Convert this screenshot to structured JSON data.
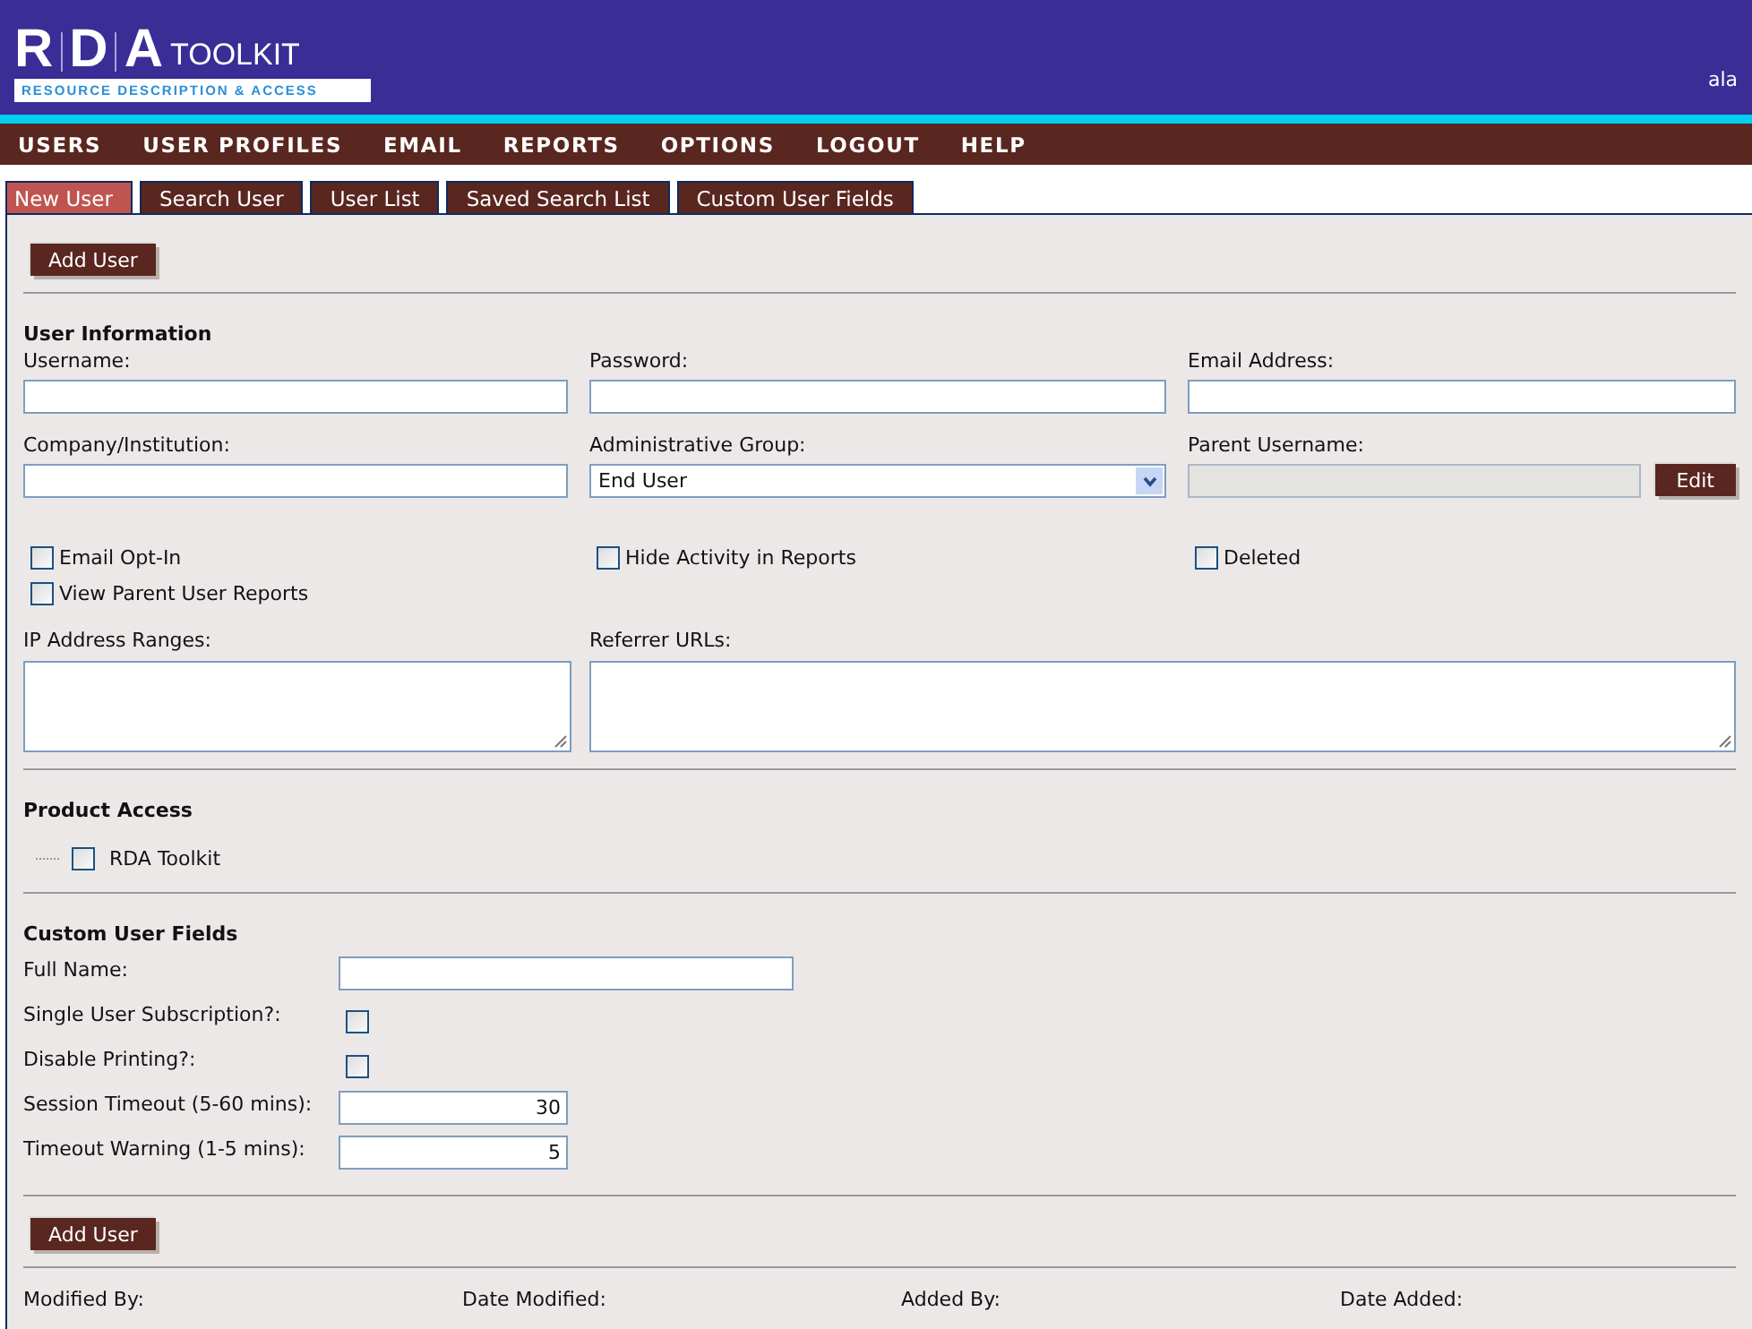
{
  "logo": {
    "letters": [
      "R",
      "D",
      "A"
    ],
    "word": "TOOLKIT",
    "tagline": "RESOURCE DESCRIPTION & ACCESS"
  },
  "current_user": "ala",
  "menu": [
    "USERS",
    "USER PROFILES",
    "EMAIL",
    "REPORTS",
    "OPTIONS",
    "LOGOUT",
    "HELP"
  ],
  "tabs": [
    {
      "label": "New User",
      "selected": true
    },
    {
      "label": "Search User",
      "selected": false
    },
    {
      "label": "User List",
      "selected": false
    },
    {
      "label": "Saved Search List",
      "selected": false
    },
    {
      "label": "Custom User Fields",
      "selected": false
    }
  ],
  "top_button": "Add User",
  "user_information": {
    "title": "User Information",
    "fields": [
      {
        "label": "Username:",
        "kind": "text"
      },
      {
        "label": "Password:",
        "kind": "text"
      },
      {
        "label": "Email Address:",
        "kind": "text"
      },
      {
        "label": "Company/Institution:",
        "kind": "text"
      },
      {
        "label": "Administrative Group:",
        "kind": "select",
        "value": "End User"
      },
      {
        "label": "Parent Username:",
        "kind": "lookup",
        "disabled": true,
        "button": "Edit"
      }
    ],
    "checkboxes": [
      {
        "label": "Email Opt-In",
        "checked": false
      },
      {
        "label": "Hide Activity in Reports",
        "checked": false
      },
      {
        "label": "Deleted",
        "checked": false
      },
      {
        "label": "View Parent User Reports",
        "checked": false
      }
    ],
    "textareas": [
      {
        "label": "IP Address Ranges:"
      },
      {
        "label": "Referrer URLs:"
      }
    ]
  },
  "product_access": {
    "title": "Product Access",
    "items": [
      {
        "label": "RDA Toolkit",
        "checked": false
      }
    ]
  },
  "custom_user_fields": {
    "title": "Custom User Fields",
    "fields": [
      {
        "label": "Full Name:",
        "kind": "text"
      },
      {
        "label": "Single User Subscription?:",
        "kind": "checkbox",
        "checked": false
      },
      {
        "label": "Disable Printing?:",
        "kind": "checkbox",
        "checked": false
      },
      {
        "label": "Session Timeout (5-60 mins):",
        "kind": "number",
        "value": "30"
      },
      {
        "label": "Timeout Warning (1-5 mins):",
        "kind": "number",
        "value": "5"
      }
    ]
  },
  "bottom_button": "Add User",
  "audit": [
    "Modified By:",
    "Date Modified:",
    "Added By:",
    "Date Added:"
  ]
}
